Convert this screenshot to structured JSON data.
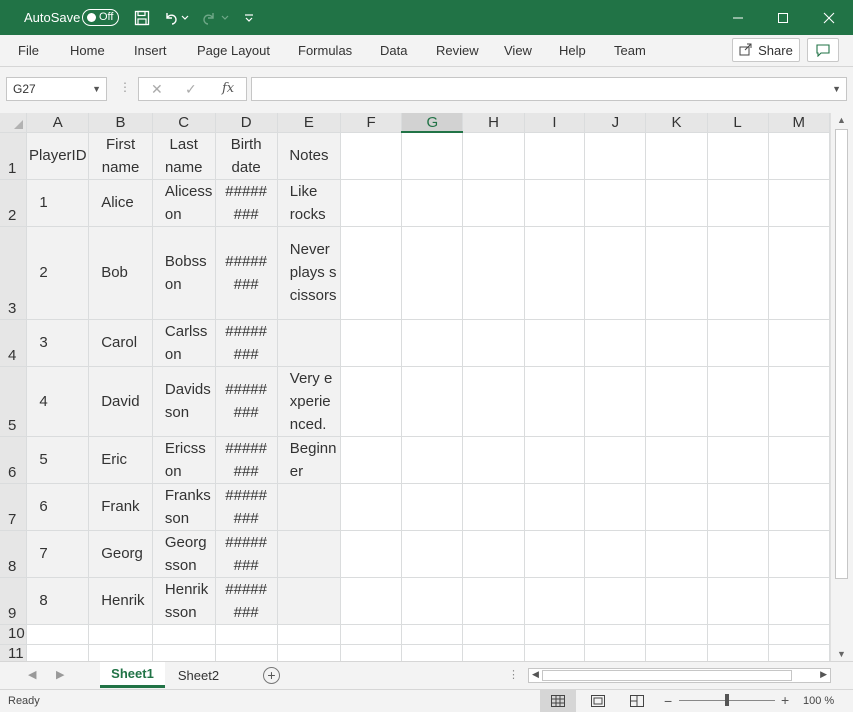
{
  "titlebar": {
    "autosave_label": "AutoSave",
    "autosave_state": "Off"
  },
  "ribbon": {
    "tabs": [
      "File",
      "Home",
      "Insert",
      "Page Layout",
      "Formulas",
      "Data",
      "Review",
      "View",
      "Help",
      "Team"
    ],
    "share_label": "Share"
  },
  "formula_bar": {
    "name_box": "G27",
    "fx_label": "fx",
    "content": ""
  },
  "sheet": {
    "selected_column": "G",
    "columns": [
      "A",
      "B",
      "C",
      "D",
      "E",
      "F",
      "G",
      "H",
      "I",
      "J",
      "K",
      "L",
      "M"
    ],
    "row_numbers": [
      "1",
      "2",
      "3",
      "4",
      "5",
      "6",
      "7",
      "8",
      "9",
      "10",
      "11"
    ],
    "headers": {
      "playerid": "PlayerID",
      "first": "First name",
      "last": "Last name",
      "birth": "Birth date",
      "notes": "Notes"
    },
    "rows": [
      {
        "id": "1",
        "first": "Alice",
        "last": "Alicesson",
        "birth": "########",
        "notes": "Like rocks"
      },
      {
        "id": "2",
        "first": "Bob",
        "last": "Bobsson",
        "birth": "########",
        "notes": "Never plays scissors"
      },
      {
        "id": "3",
        "first": "Carol",
        "last": "Carlsson",
        "birth": "########",
        "notes": ""
      },
      {
        "id": "4",
        "first": "David",
        "last": "Davidsson",
        "birth": "########",
        "notes": "Very experienced."
      },
      {
        "id": "5",
        "first": "Eric",
        "last": "Ericsson",
        "birth": "########",
        "notes": "Beginner"
      },
      {
        "id": "6",
        "first": "Frank",
        "last": "Franksson",
        "birth": "########",
        "notes": ""
      },
      {
        "id": "7",
        "first": "Georg",
        "last": "Georgsson",
        "birth": "########",
        "notes": ""
      },
      {
        "id": "8",
        "first": "Henrik",
        "last": "Henriksson",
        "birth": "########",
        "notes": ""
      }
    ]
  },
  "sheet_tabs": [
    "Sheet1",
    "Sheet2"
  ],
  "status": {
    "ready": "Ready",
    "zoom": "100 %"
  }
}
